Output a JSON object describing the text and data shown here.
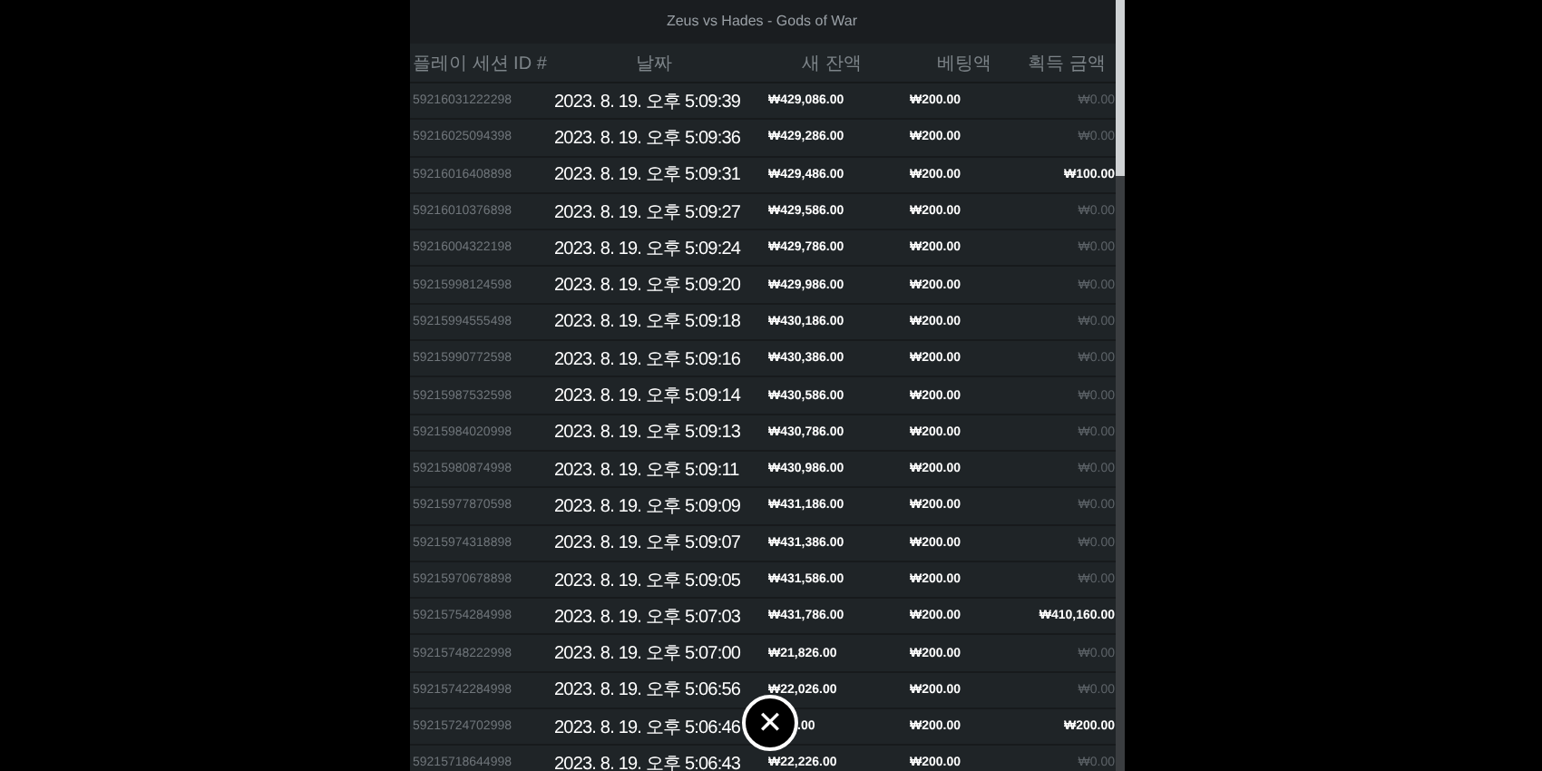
{
  "title": "Zeus vs Hades - Gods of War",
  "columns": [
    "플레이 세션 ID #",
    "날짜",
    "새 잔액",
    "베팅액",
    "획득 금액"
  ],
  "rows": [
    {
      "id": "59216031222298",
      "date": "2023. 8. 19. 오후 5:09:39",
      "balance": "₩429,086.00",
      "bet": "₩200.00",
      "win": "₩0.00",
      "won": false
    },
    {
      "id": "59216025094398",
      "date": "2023. 8. 19. 오후 5:09:36",
      "balance": "₩429,286.00",
      "bet": "₩200.00",
      "win": "₩0.00",
      "won": false
    },
    {
      "id": "59216016408898",
      "date": "2023. 8. 19. 오후 5:09:31",
      "balance": "₩429,486.00",
      "bet": "₩200.00",
      "win": "₩100.00",
      "won": true
    },
    {
      "id": "59216010376898",
      "date": "2023. 8. 19. 오후 5:09:27",
      "balance": "₩429,586.00",
      "bet": "₩200.00",
      "win": "₩0.00",
      "won": false
    },
    {
      "id": "59216004322198",
      "date": "2023. 8. 19. 오후 5:09:24",
      "balance": "₩429,786.00",
      "bet": "₩200.00",
      "win": "₩0.00",
      "won": false
    },
    {
      "id": "59215998124598",
      "date": "2023. 8. 19. 오후 5:09:20",
      "balance": "₩429,986.00",
      "bet": "₩200.00",
      "win": "₩0.00",
      "won": false
    },
    {
      "id": "59215994555498",
      "date": "2023. 8. 19. 오후 5:09:18",
      "balance": "₩430,186.00",
      "bet": "₩200.00",
      "win": "₩0.00",
      "won": false
    },
    {
      "id": "59215990772598",
      "date": "2023. 8. 19. 오후 5:09:16",
      "balance": "₩430,386.00",
      "bet": "₩200.00",
      "win": "₩0.00",
      "won": false
    },
    {
      "id": "59215987532598",
      "date": "2023. 8. 19. 오후 5:09:14",
      "balance": "₩430,586.00",
      "bet": "₩200.00",
      "win": "₩0.00",
      "won": false
    },
    {
      "id": "59215984020998",
      "date": "2023. 8. 19. 오후 5:09:13",
      "balance": "₩430,786.00",
      "bet": "₩200.00",
      "win": "₩0.00",
      "won": false
    },
    {
      "id": "59215980874998",
      "date": "2023. 8. 19. 오후 5:09:11",
      "balance": "₩430,986.00",
      "bet": "₩200.00",
      "win": "₩0.00",
      "won": false
    },
    {
      "id": "59215977870598",
      "date": "2023. 8. 19. 오후 5:09:09",
      "balance": "₩431,186.00",
      "bet": "₩200.00",
      "win": "₩0.00",
      "won": false
    },
    {
      "id": "59215974318898",
      "date": "2023. 8. 19. 오후 5:09:07",
      "balance": "₩431,386.00",
      "bet": "₩200.00",
      "win": "₩0.00",
      "won": false
    },
    {
      "id": "59215970678898",
      "date": "2023. 8. 19. 오후 5:09:05",
      "balance": "₩431,586.00",
      "bet": "₩200.00",
      "win": "₩0.00",
      "won": false
    },
    {
      "id": "59215754284998",
      "date": "2023. 8. 19. 오후 5:07:03",
      "balance": "₩431,786.00",
      "bet": "₩200.00",
      "win": "₩410,160.00",
      "won": true
    },
    {
      "id": "59215748222998",
      "date": "2023. 8. 19. 오후 5:07:00",
      "balance": "₩21,826.00",
      "bet": "₩200.00",
      "win": "₩0.00",
      "won": false
    },
    {
      "id": "59215742284998",
      "date": "2023. 8. 19. 오후 5:06:56",
      "balance": "₩22,026.00",
      "bet": "₩200.00",
      "win": "₩0.00",
      "won": false
    },
    {
      "id": "59215724702998",
      "date": "2023. 8. 19. 오후 5:06:46",
      "balance": ".00",
      "covered": true,
      "bet": "₩200.00",
      "win": "₩200.00",
      "won": true
    },
    {
      "id": "59215718644998",
      "date": "2023. 8. 19. 오후 5:06:43",
      "balance": "₩22,226.00",
      "bet": "₩200.00",
      "win": "₩0.00",
      "won": false
    }
  ],
  "close_button": {
    "label": "✕"
  }
}
